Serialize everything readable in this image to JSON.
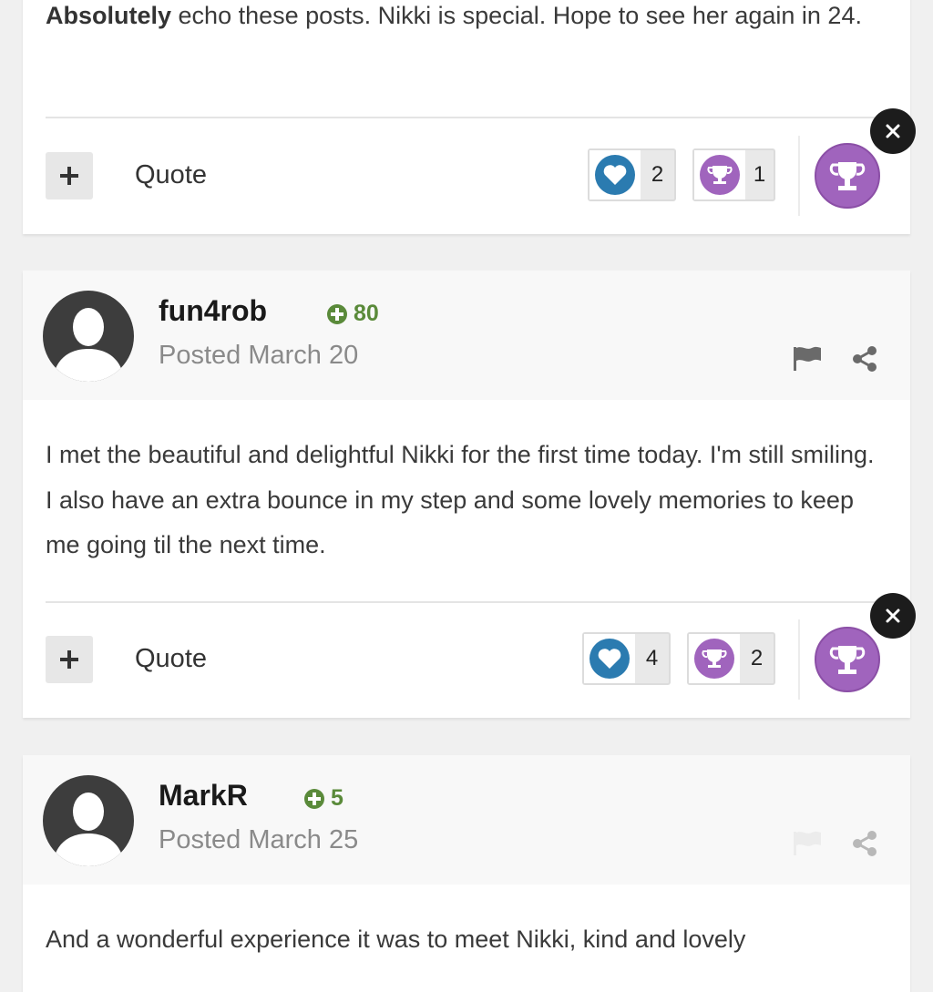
{
  "posts": [
    {
      "text_bold": "Absolutely",
      "text_rest": " echo these posts. Nikki is special. Hope to see her again in 24.",
      "footer": {
        "add_label": "+",
        "quote_label": "Quote",
        "likes": "2",
        "trophies": "1"
      }
    },
    {
      "author": "fun4rob",
      "reputation": "80",
      "posted": "Posted March 20",
      "text": "I met the beautiful and delightful Nikki for the first time today. I'm still smiling. I also have an extra bounce in my step and some lovely memories to keep me going til the next time.",
      "footer": {
        "add_label": "+",
        "quote_label": "Quote",
        "likes": "4",
        "trophies": "2"
      }
    },
    {
      "author": "MarkR",
      "reputation": "5",
      "posted": "Posted March 25",
      "text": "And a wonderful experience it was to meet Nikki, kind and lovely"
    }
  ],
  "colors": {
    "like": "#2b7bb0",
    "trophy": "#a064bd",
    "reputation": "#5a8a3a",
    "close": "#1c1c1c"
  },
  "icons": {
    "add": "plus-icon",
    "like": "heart-icon",
    "trophy": "trophy-icon",
    "close": "close-icon",
    "report": "flag-icon",
    "share": "share-icon",
    "avatar": "default-avatar-icon",
    "reputation": "plus-circle-icon"
  }
}
